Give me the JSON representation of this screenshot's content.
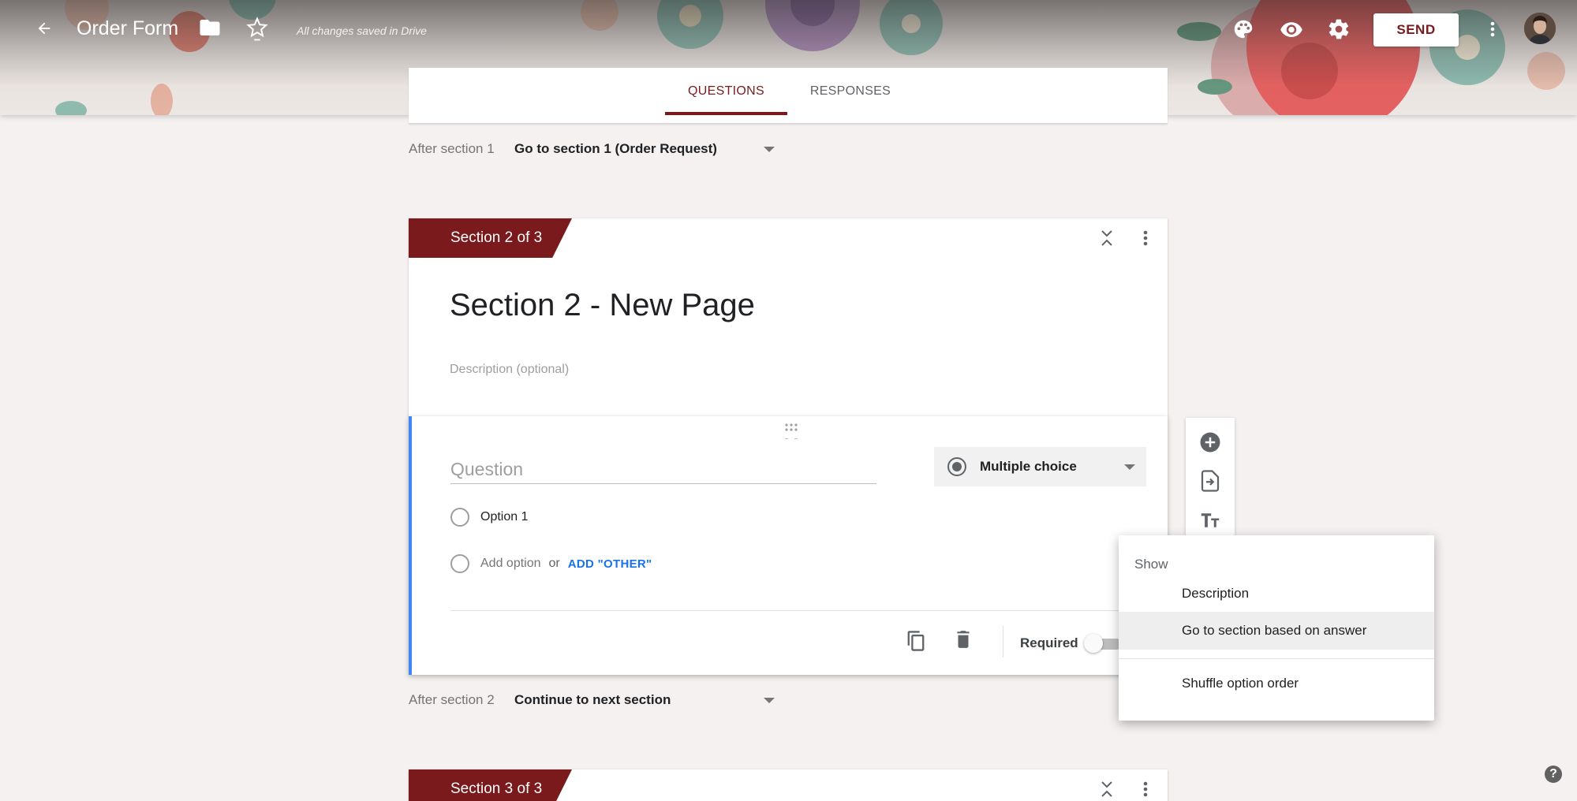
{
  "header": {
    "title": "Order Form",
    "save_status": "All changes saved in Drive",
    "send_label": "SEND",
    "icons": [
      "back-arrow-icon",
      "folder-icon",
      "star-icon",
      "palette-icon",
      "eye-icon",
      "gear-icon",
      "more-vert-icon",
      "avatar"
    ]
  },
  "tabs": {
    "questions": "QUESTIONS",
    "responses": "RESPONSES"
  },
  "after_section_1": {
    "label": "After section 1",
    "value": "Go to section 1 (Order Request)"
  },
  "section_2": {
    "badge": "Section 2 of 3",
    "title": "Section 2 - New Page",
    "description_placeholder": "Description (optional)"
  },
  "question": {
    "placeholder": "Question",
    "type": "Multiple choice",
    "option_1": "Option 1",
    "add_option": "Add option",
    "or": "or",
    "add_other": "ADD \"OTHER\"",
    "required_label": "Required",
    "required": false
  },
  "after_section_2": {
    "label": "After section 2",
    "value": "Continue to next section"
  },
  "section_3": {
    "badge": "Section 3 of 3"
  },
  "menu": {
    "header": "Show",
    "items": [
      "Description",
      "Go to section based on answer",
      "Shuffle option order"
    ]
  },
  "help_label": "?",
  "colors": {
    "accent": "#7a1a1c",
    "focus": "#4285f4",
    "link": "#1a73e8"
  }
}
